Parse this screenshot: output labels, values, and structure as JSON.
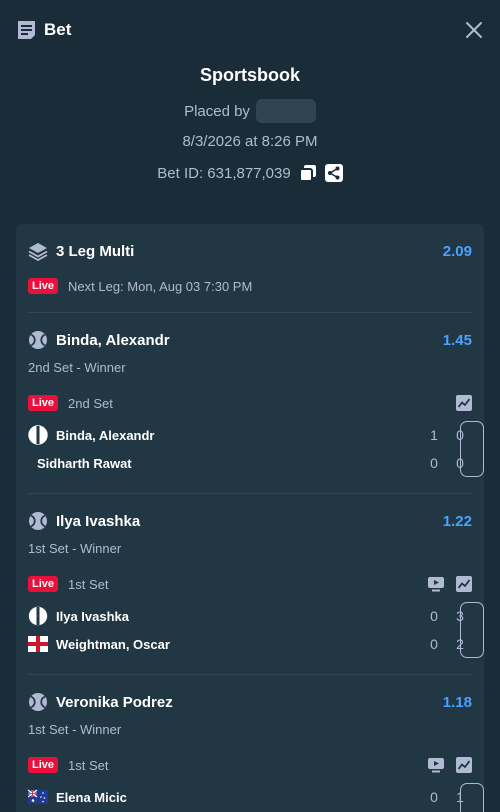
{
  "header": {
    "title": "Bet",
    "bet_icon": "receipt-icon",
    "close_icon": "close-icon"
  },
  "summary": {
    "book": "Sportsbook",
    "placed_by": "Placed by",
    "date": "8/3/2026 at 8:26 PM",
    "bet_id": "Bet ID: 631,877,039",
    "copy_icon": "copy-icon",
    "share_icon": "share-icon"
  },
  "multi": {
    "title": "3 Leg Multi",
    "odds": "2.09",
    "live": "Live",
    "next_leg": "Next Leg: Mon, Aug 03 7:30 PM"
  },
  "legs": [
    {
      "title": "Binda, Alexandr",
      "odds": "1.45",
      "market": "2nd Set - Winner",
      "live": "Live",
      "period": "2nd Set",
      "players": [
        {
          "name": "Binda, Alexandr",
          "flag": "white-flag",
          "sets": "1",
          "games": "0"
        },
        {
          "name": "Sidharth Rawat",
          "flag": "",
          "sets": "0",
          "games": "0"
        }
      ]
    },
    {
      "title": "Ilya Ivashka",
      "odds": "1.22",
      "market": "1st Set - Winner",
      "live": "Live",
      "period": "1st Set",
      "players": [
        {
          "name": "Ilya Ivashka",
          "flag": "white-flag",
          "sets": "0",
          "games": "3"
        },
        {
          "name": "Weightman, Oscar",
          "flag": "england-flag",
          "sets": "0",
          "games": "2"
        }
      ]
    },
    {
      "title": "Veronika Podrez",
      "odds": "1.18",
      "market": "1st Set - Winner",
      "live": "Live",
      "period": "1st Set",
      "players": [
        {
          "name": "Elena Micic",
          "flag": "australia-flag",
          "sets": "0",
          "games": "1"
        }
      ]
    }
  ],
  "colors": {
    "background": "#1a2c38",
    "card": "#213743",
    "accent": "#4aa1ff",
    "live": "#e9113c",
    "muted": "#b1bad3"
  }
}
